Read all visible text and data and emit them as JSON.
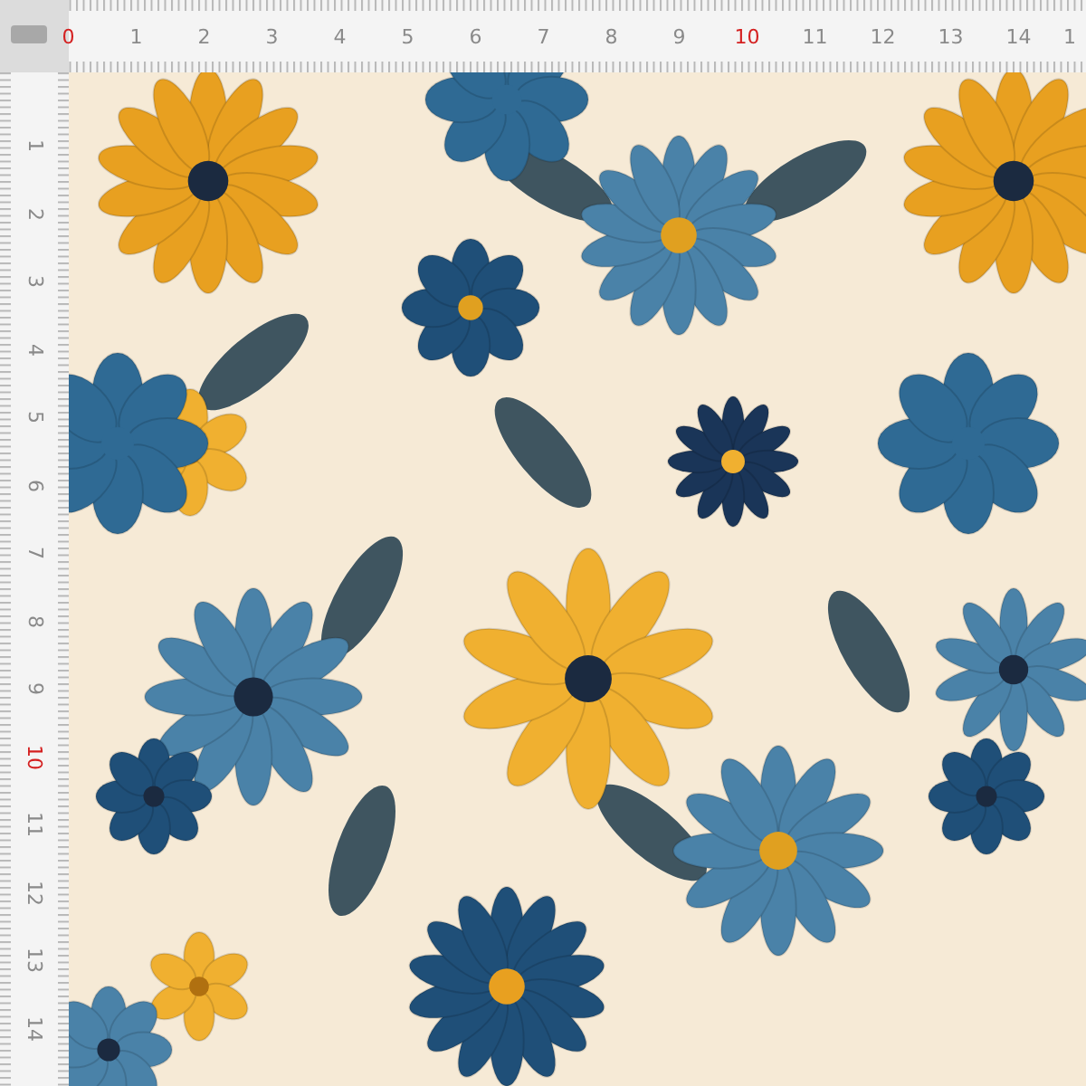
{
  "top_ruler": {
    "labels": [
      {
        "text": "0",
        "color": "#d42020"
      },
      {
        "text": "1",
        "color": "#8a8a8a"
      },
      {
        "text": "2",
        "color": "#8a8a8a"
      },
      {
        "text": "3",
        "color": "#8a8a8a"
      },
      {
        "text": "4",
        "color": "#8a8a8a"
      },
      {
        "text": "5",
        "color": "#8a8a8a"
      },
      {
        "text": "6",
        "color": "#8a8a8a"
      },
      {
        "text": "7",
        "color": "#8a8a8a"
      },
      {
        "text": "8",
        "color": "#8a8a8a"
      },
      {
        "text": "9",
        "color": "#8a8a8a"
      },
      {
        "text": "10",
        "color": "#d42020"
      },
      {
        "text": "11",
        "color": "#8a8a8a"
      },
      {
        "text": "12",
        "color": "#8a8a8a"
      },
      {
        "text": "13",
        "color": "#8a8a8a"
      },
      {
        "text": "14",
        "color": "#8a8a8a"
      },
      {
        "text": "1",
        "color": "#8a8a8a"
      }
    ]
  },
  "left_ruler": {
    "labels": [
      {
        "text": "1",
        "color": "#8a8a8a"
      },
      {
        "text": "2",
        "color": "#8a8a8a"
      },
      {
        "text": "3",
        "color": "#8a8a8a"
      },
      {
        "text": "4",
        "color": "#8a8a8a"
      },
      {
        "text": "5",
        "color": "#8a8a8a"
      },
      {
        "text": "6",
        "color": "#8a8a8a"
      },
      {
        "text": "7",
        "color": "#8a8a8a"
      },
      {
        "text": "8",
        "color": "#8a8a8a"
      },
      {
        "text": "9",
        "color": "#8a8a8a"
      },
      {
        "text": "10",
        "color": "#d42020"
      },
      {
        "text": "11",
        "color": "#8a8a8a"
      },
      {
        "text": "12",
        "color": "#8a8a8a"
      },
      {
        "text": "13",
        "color": "#8a8a8a"
      },
      {
        "text": "14",
        "color": "#8a8a8a"
      }
    ]
  }
}
